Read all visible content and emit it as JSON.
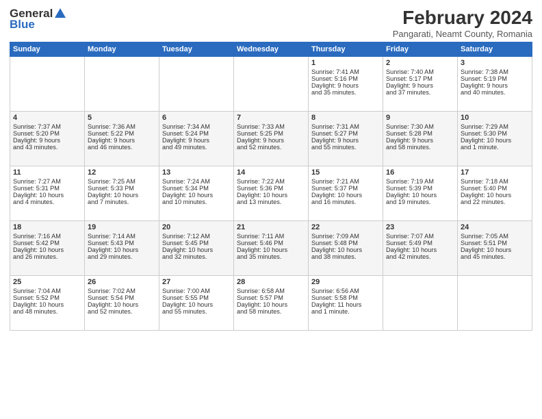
{
  "header": {
    "logo_general": "General",
    "logo_blue": "Blue",
    "month_year": "February 2024",
    "location": "Pangarati, Neamt County, Romania"
  },
  "days_of_week": [
    "Sunday",
    "Monday",
    "Tuesday",
    "Wednesday",
    "Thursday",
    "Friday",
    "Saturday"
  ],
  "weeks": [
    [
      {
        "day": "",
        "content": ""
      },
      {
        "day": "",
        "content": ""
      },
      {
        "day": "",
        "content": ""
      },
      {
        "day": "",
        "content": ""
      },
      {
        "day": "1",
        "content": "Sunrise: 7:41 AM\nSunset: 5:16 PM\nDaylight: 9 hours\nand 35 minutes."
      },
      {
        "day": "2",
        "content": "Sunrise: 7:40 AM\nSunset: 5:17 PM\nDaylight: 9 hours\nand 37 minutes."
      },
      {
        "day": "3",
        "content": "Sunrise: 7:38 AM\nSunset: 5:19 PM\nDaylight: 9 hours\nand 40 minutes."
      }
    ],
    [
      {
        "day": "4",
        "content": "Sunrise: 7:37 AM\nSunset: 5:20 PM\nDaylight: 9 hours\nand 43 minutes."
      },
      {
        "day": "5",
        "content": "Sunrise: 7:36 AM\nSunset: 5:22 PM\nDaylight: 9 hours\nand 46 minutes."
      },
      {
        "day": "6",
        "content": "Sunrise: 7:34 AM\nSunset: 5:24 PM\nDaylight: 9 hours\nand 49 minutes."
      },
      {
        "day": "7",
        "content": "Sunrise: 7:33 AM\nSunset: 5:25 PM\nDaylight: 9 hours\nand 52 minutes."
      },
      {
        "day": "8",
        "content": "Sunrise: 7:31 AM\nSunset: 5:27 PM\nDaylight: 9 hours\nand 55 minutes."
      },
      {
        "day": "9",
        "content": "Sunrise: 7:30 AM\nSunset: 5:28 PM\nDaylight: 9 hours\nand 58 minutes."
      },
      {
        "day": "10",
        "content": "Sunrise: 7:29 AM\nSunset: 5:30 PM\nDaylight: 10 hours\nand 1 minute."
      }
    ],
    [
      {
        "day": "11",
        "content": "Sunrise: 7:27 AM\nSunset: 5:31 PM\nDaylight: 10 hours\nand 4 minutes."
      },
      {
        "day": "12",
        "content": "Sunrise: 7:25 AM\nSunset: 5:33 PM\nDaylight: 10 hours\nand 7 minutes."
      },
      {
        "day": "13",
        "content": "Sunrise: 7:24 AM\nSunset: 5:34 PM\nDaylight: 10 hours\nand 10 minutes."
      },
      {
        "day": "14",
        "content": "Sunrise: 7:22 AM\nSunset: 5:36 PM\nDaylight: 10 hours\nand 13 minutes."
      },
      {
        "day": "15",
        "content": "Sunrise: 7:21 AM\nSunset: 5:37 PM\nDaylight: 10 hours\nand 16 minutes."
      },
      {
        "day": "16",
        "content": "Sunrise: 7:19 AM\nSunset: 5:39 PM\nDaylight: 10 hours\nand 19 minutes."
      },
      {
        "day": "17",
        "content": "Sunrise: 7:18 AM\nSunset: 5:40 PM\nDaylight: 10 hours\nand 22 minutes."
      }
    ],
    [
      {
        "day": "18",
        "content": "Sunrise: 7:16 AM\nSunset: 5:42 PM\nDaylight: 10 hours\nand 26 minutes."
      },
      {
        "day": "19",
        "content": "Sunrise: 7:14 AM\nSunset: 5:43 PM\nDaylight: 10 hours\nand 29 minutes."
      },
      {
        "day": "20",
        "content": "Sunrise: 7:12 AM\nSunset: 5:45 PM\nDaylight: 10 hours\nand 32 minutes."
      },
      {
        "day": "21",
        "content": "Sunrise: 7:11 AM\nSunset: 5:46 PM\nDaylight: 10 hours\nand 35 minutes."
      },
      {
        "day": "22",
        "content": "Sunrise: 7:09 AM\nSunset: 5:48 PM\nDaylight: 10 hours\nand 38 minutes."
      },
      {
        "day": "23",
        "content": "Sunrise: 7:07 AM\nSunset: 5:49 PM\nDaylight: 10 hours\nand 42 minutes."
      },
      {
        "day": "24",
        "content": "Sunrise: 7:05 AM\nSunset: 5:51 PM\nDaylight: 10 hours\nand 45 minutes."
      }
    ],
    [
      {
        "day": "25",
        "content": "Sunrise: 7:04 AM\nSunset: 5:52 PM\nDaylight: 10 hours\nand 48 minutes."
      },
      {
        "day": "26",
        "content": "Sunrise: 7:02 AM\nSunset: 5:54 PM\nDaylight: 10 hours\nand 52 minutes."
      },
      {
        "day": "27",
        "content": "Sunrise: 7:00 AM\nSunset: 5:55 PM\nDaylight: 10 hours\nand 55 minutes."
      },
      {
        "day": "28",
        "content": "Sunrise: 6:58 AM\nSunset: 5:57 PM\nDaylight: 10 hours\nand 58 minutes."
      },
      {
        "day": "29",
        "content": "Sunrise: 6:56 AM\nSunset: 5:58 PM\nDaylight: 11 hours\nand 1 minute."
      },
      {
        "day": "",
        "content": ""
      },
      {
        "day": "",
        "content": ""
      }
    ]
  ]
}
